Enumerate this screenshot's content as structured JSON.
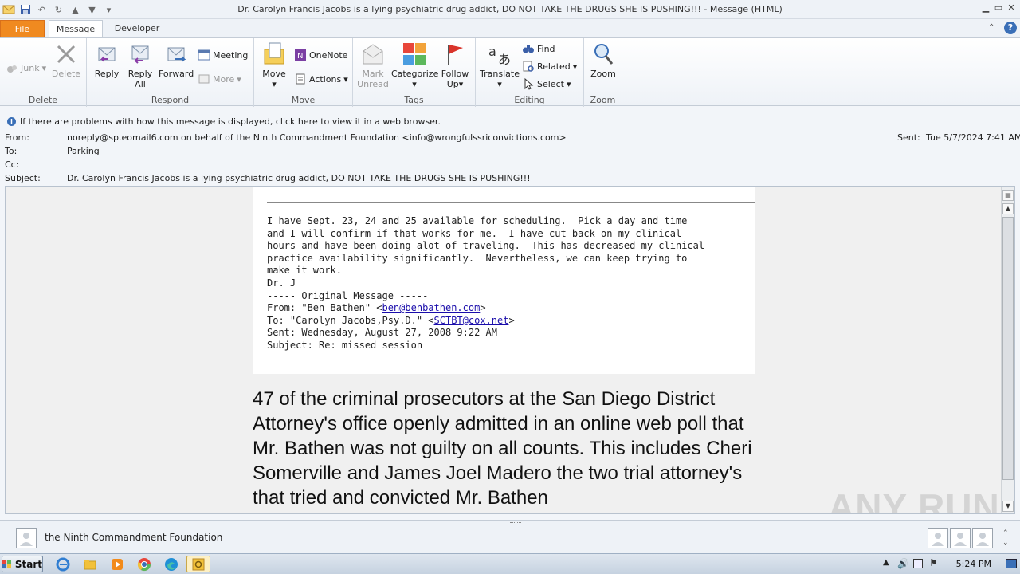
{
  "window": {
    "title": "Dr. Carolyn Francis Jacobs is a lying psychiatric drug addict, DO NOT TAKE THE DRUGS SHE IS PUSHING!!! - Message (HTML)"
  },
  "tabs": [
    {
      "label": "File"
    },
    {
      "label": "Message"
    },
    {
      "label": "Developer"
    }
  ],
  "ribbon": {
    "delete_group": {
      "label": "Delete",
      "junk": "Junk",
      "delete": "Delete"
    },
    "respond_group": {
      "label": "Respond",
      "reply": "Reply",
      "reply_all_1": "Reply",
      "reply_all_2": "All",
      "forward": "Forward",
      "meeting": "Meeting",
      "more": "More"
    },
    "move_group": {
      "label": "Move",
      "move": "Move",
      "onenote": "OneNote",
      "actions": "Actions"
    },
    "tags_group": {
      "label": "Tags",
      "mark_unread_1": "Mark",
      "mark_unread_2": "Unread",
      "categorize": "Categorize",
      "follow_up_1": "Follow",
      "follow_up_2": "Up"
    },
    "editing_group": {
      "label": "Editing",
      "translate": "Translate",
      "find": "Find",
      "related": "Related",
      "select": "Select"
    },
    "zoom_group": {
      "label": "Zoom",
      "zoom": "Zoom"
    }
  },
  "info": {
    "message": "If there are problems with how this message is displayed, click here to view it in a web browser."
  },
  "header": {
    "from_label": "From:",
    "from_value": "noreply@sp.eomail6.com on behalf of the Ninth Commandment Foundation <info@wrongfulssriconvictions.com>",
    "to_label": "To:",
    "to_value": "Parking",
    "cc_label": "Cc:",
    "cc_value": "",
    "subject_label": "Subject:",
    "subject_value": "Dr. Carolyn Francis Jacobs is a lying psychiatric drug addict, DO NOT TAKE THE DRUGS SHE IS PUSHING!!!",
    "sent_label": "Sent:",
    "sent_value": "Tue 5/7/2024 7:41 AM"
  },
  "body": {
    "mono_lines": [
      "I have Sept. 23, 24 and 25 available for scheduling.  Pick a day and time",
      "and I will confirm if that works for me.  I have cut back on my clinical",
      "hours and have been doing alot of traveling.  This has decreased my clinical",
      "practice availability significantly.  Nevertheless, we can keep trying to",
      "make it work.",
      "Dr. J",
      "----- Original Message -----"
    ],
    "from_prefix": "From: \"Ben Bathen\" <",
    "from_link": "ben@benbathen.com",
    "from_suffix": ">",
    "to_prefix": "To: \"Carolyn Jacobs,Psy.D.\" <",
    "to_link": "SCTBT@cox.net",
    "to_suffix": ">",
    "sent_line": "Sent: Wednesday, August 27, 2008 9:22 AM",
    "subject_line": "Subject: Re: missed session",
    "big_text": "47 of the criminal prosecutors at the San Diego District Attorney's office openly admitted in an online web poll that Mr. Bathen was not guilty on all counts. This includes Cheri Somerville and James Joel Madero the two trial attorney's that tried and convicted Mr. Bathen"
  },
  "watermark": "ANY RUN",
  "people": {
    "sender_name": "the Ninth Commandment Foundation"
  },
  "taskbar": {
    "start_label": "Start",
    "clock": "5:24 PM"
  },
  "colors": {
    "file_tab": "#f08a20",
    "link": "#1a0dab",
    "info_icon": "#3a6fb7"
  }
}
